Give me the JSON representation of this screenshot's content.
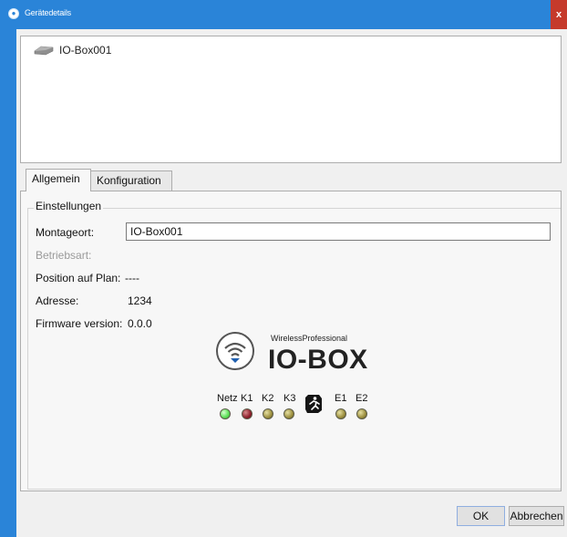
{
  "window": {
    "title": "Gerätedetails",
    "close_glyph": "x"
  },
  "tree": {
    "items": [
      {
        "label": "IO-Box001",
        "icon": "device-icon"
      }
    ]
  },
  "tabs": [
    {
      "label": "Allgemein",
      "active": true
    },
    {
      "label": "Konfiguration",
      "active": false
    }
  ],
  "settings": {
    "group_title": "Einstellungen",
    "montageort_label": "Montageort:",
    "montageort_value": "IO-Box001",
    "betriebsart_label": "Betriebsart:",
    "position_label": "Position auf Plan:",
    "position_value": "----",
    "adresse_label": "Adresse:",
    "adresse_value": "1234",
    "firmware_label": "Firmware version:",
    "firmware_value": "0.0.0"
  },
  "logo": {
    "small": "WirelessProfessional",
    "big": "IO-BOX",
    "icon": "wifi-icon"
  },
  "leds": [
    {
      "label": "Netz",
      "color": "green"
    },
    {
      "label": "K1",
      "color": "red"
    },
    {
      "label": "K2",
      "color": "olive"
    },
    {
      "label": "K3",
      "color": "olive"
    },
    {
      "label": "E1",
      "color": "olive"
    },
    {
      "label": "E2",
      "color": "olive"
    }
  ],
  "buttons": {
    "ok": "OK",
    "cancel": "Abbrechen"
  }
}
